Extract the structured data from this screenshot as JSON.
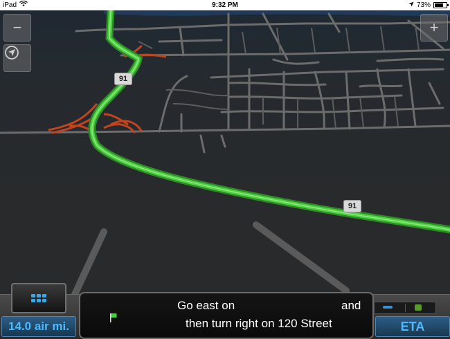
{
  "status_bar": {
    "device": "iPad",
    "time": "9:32 PM",
    "battery_text": "73%",
    "battery_level": 0.73
  },
  "map": {
    "route_shields": [
      "91",
      "91"
    ],
    "zoom_in_label": "+",
    "zoom_out_label": "−"
  },
  "navigation": {
    "instruction_line1_start": "Go east on",
    "instruction_line1_end": "and",
    "instruction_line2": "then turn right on 120 Street",
    "distance": "14.0 air mi.",
    "eta_label": "ETA"
  },
  "colors": {
    "route": "#3fc033",
    "ramps": "#c0451f",
    "accent": "#4db8ff"
  }
}
